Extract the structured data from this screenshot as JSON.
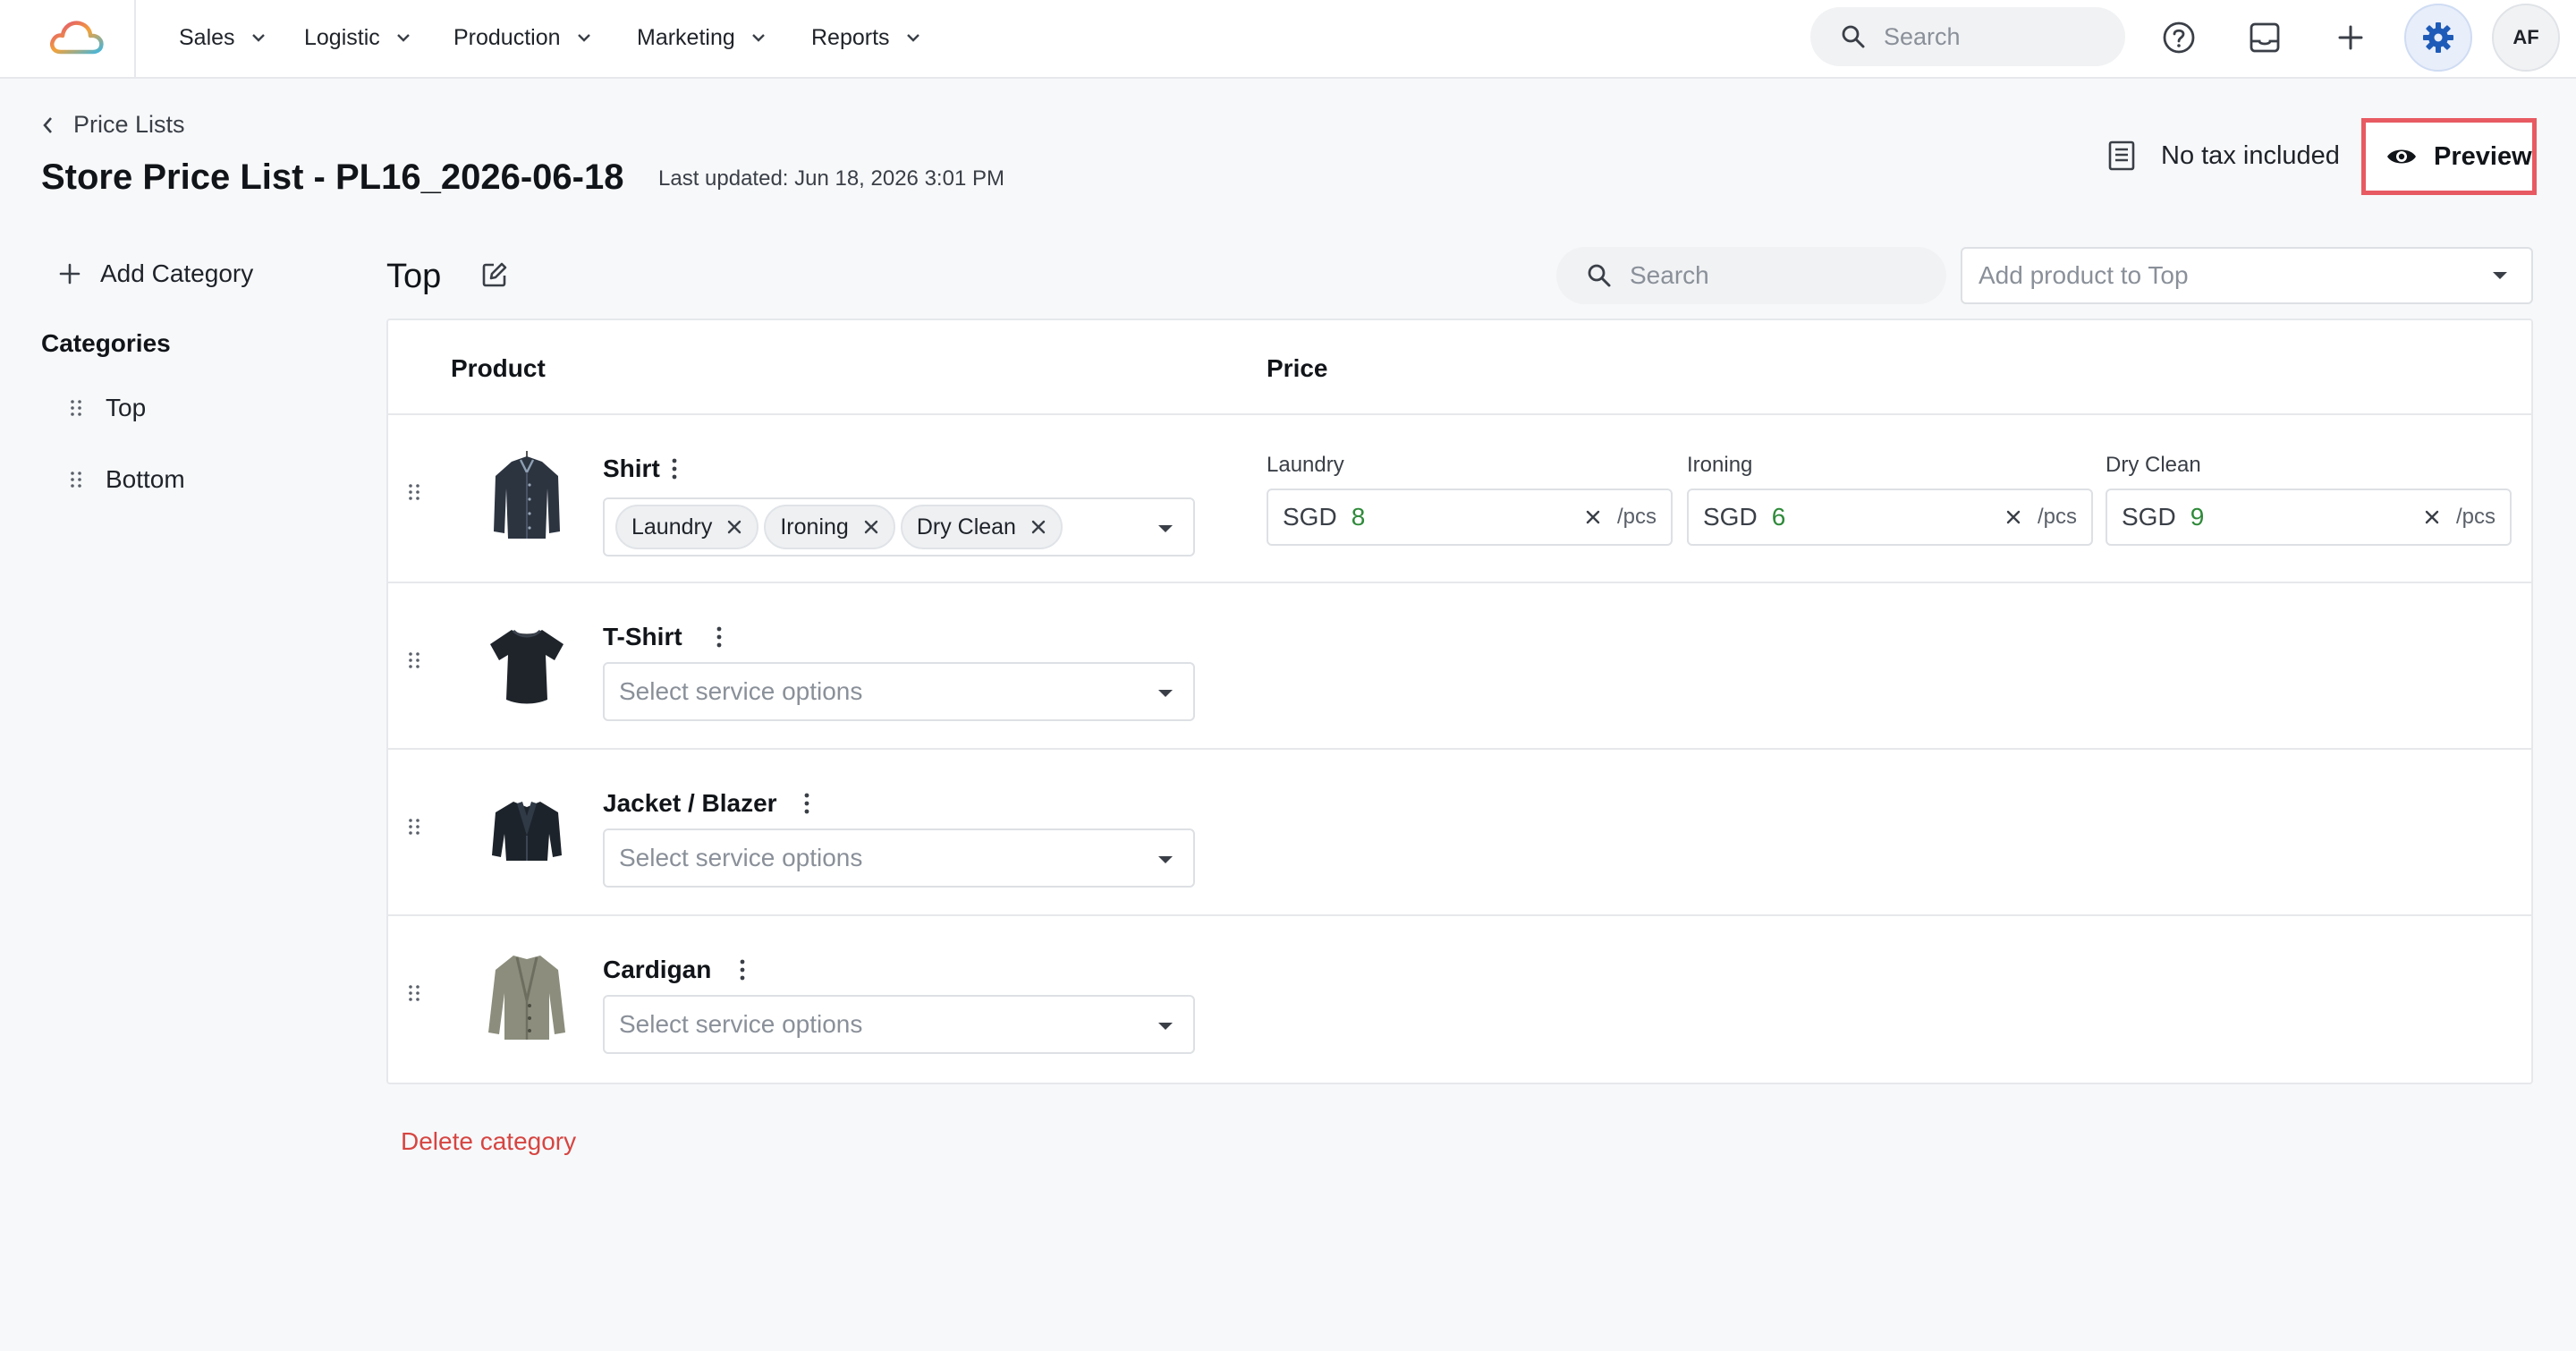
{
  "nav": {
    "items": [
      {
        "label": "Sales"
      },
      {
        "label": "Logistic"
      },
      {
        "label": "Production"
      },
      {
        "label": "Marketing"
      },
      {
        "label": "Reports"
      }
    ],
    "search_placeholder": "Search",
    "avatar_initials": "AF",
    "icons": [
      "help-circle-icon",
      "inbox-icon",
      "plus-icon",
      "gear-icon"
    ],
    "accent_color": "#1e5bb8"
  },
  "header": {
    "back_label": "Price Lists",
    "title": "Store Price List - PL16_2026-06-18",
    "last_updated": "Last updated: Jun 18, 2026 3:01 PM",
    "tax_label": "No tax included",
    "preview_label": "Preview",
    "highlight_color": "#e85a61"
  },
  "sidebar": {
    "add_category_label": "Add Category",
    "categories_heading": "Categories",
    "categories": [
      {
        "label": "Top"
      },
      {
        "label": "Bottom"
      }
    ]
  },
  "main": {
    "category_title": "Top",
    "search_placeholder": "Search",
    "add_product_placeholder": "Add product to Top",
    "columns": {
      "product": "Product",
      "price": "Price"
    },
    "service_placeholder": "Select service options",
    "products": [
      {
        "name": "Shirt",
        "services": [
          "Laundry",
          "Ironing",
          "Dry Clean"
        ],
        "prices": [
          {
            "service": "Laundry",
            "currency": "SGD",
            "value": "8",
            "unit": "/pcs"
          },
          {
            "service": "Ironing",
            "currency": "SGD",
            "value": "6",
            "unit": "/pcs"
          },
          {
            "service": "Dry Clean",
            "currency": "SGD",
            "value": "9",
            "unit": "/pcs"
          }
        ]
      },
      {
        "name": "T-Shirt",
        "services": [],
        "prices": []
      },
      {
        "name": "Jacket / Blazer",
        "services": [],
        "prices": []
      },
      {
        "name": "Cardigan",
        "services": [],
        "prices": []
      }
    ],
    "delete_category_label": "Delete category",
    "price_value_color": "#2f8a3a",
    "delete_color": "#d64541"
  }
}
